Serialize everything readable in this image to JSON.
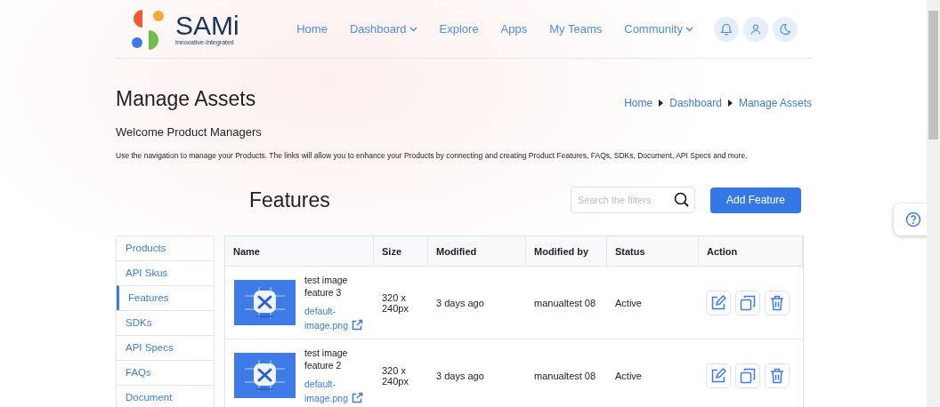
{
  "brand": {
    "name": "SAMi",
    "tagline": "Innovative-Integrated"
  },
  "nav": [
    {
      "label": "Home",
      "kind": "link"
    },
    {
      "label": "Dashboard",
      "kind": "dropdown"
    },
    {
      "label": "Explore",
      "kind": "link"
    },
    {
      "label": "Apps",
      "kind": "link"
    },
    {
      "label": "My Teams",
      "kind": "link"
    },
    {
      "label": "Community",
      "kind": "dropdown"
    }
  ],
  "page_title": "Manage Assets",
  "breadcrumb": [
    "Home",
    "Dashboard",
    "Manage Assets"
  ],
  "welcome": "Welcome Product Managers",
  "description": "Use the navigation to manage your Products. The links will allow you to enhance your Products by connecting and creating Product Features, FAQs, SDKs, Document, API Specs and more.",
  "section_title": "Features",
  "search": {
    "placeholder": "Search the filters"
  },
  "add_button": "Add Feature",
  "sidebar": [
    {
      "label": "Products",
      "selected": false
    },
    {
      "label": "API Skus",
      "selected": false
    },
    {
      "label": "Features",
      "selected": true
    },
    {
      "label": "SDKs",
      "selected": false
    },
    {
      "label": "API Specs",
      "selected": false
    },
    {
      "label": "FAQs",
      "selected": false
    },
    {
      "label": "Document",
      "selected": false
    }
  ],
  "table": {
    "columns": [
      "Name",
      "Size",
      "Modified",
      "Modified by",
      "Status",
      "Action"
    ],
    "rows": [
      {
        "name": "test image feature 3",
        "file": "default-image.png",
        "size": "320 x 240px",
        "modified": "3 days ago",
        "modified_by": "manualtest 08",
        "status": "Active"
      },
      {
        "name": "test image feature 2",
        "file": "default-image.png",
        "size": "320 x 240px",
        "modified": "3 days ago",
        "modified_by": "manualtest 08",
        "status": "Active"
      }
    ]
  }
}
